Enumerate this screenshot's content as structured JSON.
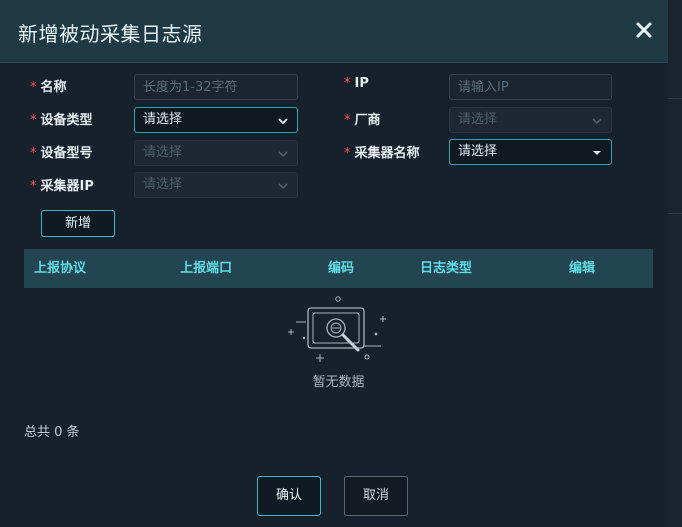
{
  "dialog": {
    "title": "新增被动采集日志源",
    "close_icon": "close-icon"
  },
  "form": {
    "name": {
      "label": "名称",
      "placeholder": "长度为1-32字符",
      "value": ""
    },
    "ip": {
      "label": "IP",
      "placeholder": "请输入IP",
      "value": ""
    },
    "device_type": {
      "label": "设备类型",
      "value": "请选择"
    },
    "vendor": {
      "label": "厂商",
      "value": "请选择"
    },
    "device_model": {
      "label": "设备型号",
      "value": "请选择"
    },
    "collector_name": {
      "label": "采集器名称",
      "value": "请选择"
    },
    "collector_ip": {
      "label": "采集器IP",
      "value": "请选择"
    },
    "required_mark": "*",
    "add_button": "新增"
  },
  "table": {
    "columns": [
      "上报协议",
      "上报端口",
      "编码",
      "日志类型",
      "编辑"
    ],
    "rows": [],
    "empty_text": "暂无数据",
    "empty_icon": "empty-data-icon"
  },
  "pagination": {
    "total_text": "总共 0 条"
  },
  "footer": {
    "confirm_label": "确认",
    "cancel_label": "取消"
  },
  "colors": {
    "accent": "#3db7c4",
    "header_bg": "#1f3a44",
    "table_header_bg": "#234451",
    "table_header_text": "#5fdde6",
    "required": "#ff4d4f"
  }
}
